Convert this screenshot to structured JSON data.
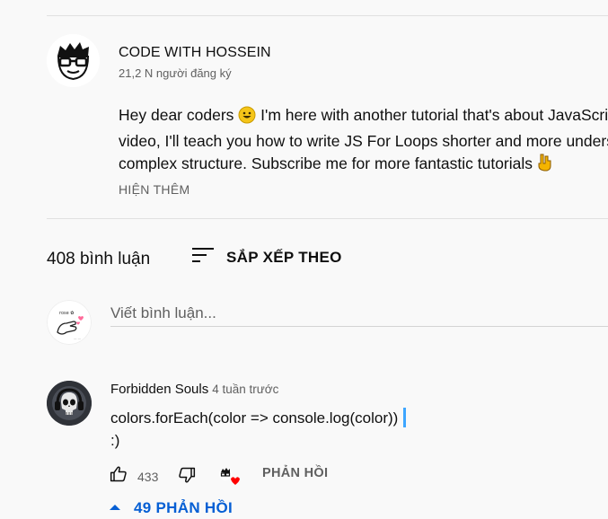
{
  "channel": {
    "name": "CODE WITH HOSSEIN",
    "subscribers": "21,2 N người đăng ký"
  },
  "description": {
    "line1_a": "Hey dear coders ",
    "line1_b": " I'm here with another tutorial that's about JavaScript.",
    "line2": "video, I'll teach you how to write JS For Loops shorter and more understandable",
    "line3": "complex structure. Subscribe me for more fantastic tutorials ",
    "show_more": "HIỆN THÊM"
  },
  "comments_header": {
    "count": "408 bình luận",
    "sort_label": "SẮP XẾP THEO"
  },
  "new_comment": {
    "placeholder": "Viết bình luận..."
  },
  "comments": [
    {
      "author": "Forbidden Souls",
      "time": "4 tuần trước",
      "text_line1": "colors.forEach(color => console.log(color))",
      "text_line2": ":)",
      "likes": "433",
      "reply_label": "PHẢN HỒI",
      "replies_label": "49 PHẢN HỒI"
    }
  ],
  "colors": {
    "background": "#f9f9f9",
    "secondary_text": "#606060",
    "link_blue": "#065fd4",
    "heart": "#ff0000"
  }
}
